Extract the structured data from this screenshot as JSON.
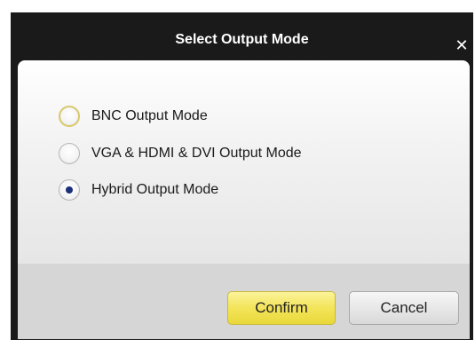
{
  "dialog": {
    "title": "Select Output Mode",
    "close_glyph": "✕",
    "close_icon": "close-icon"
  },
  "options": [
    {
      "label": "BNC Output Mode",
      "checked": false
    },
    {
      "label": "VGA & HDMI & DVI Output Mode",
      "checked": false
    },
    {
      "label": "Hybrid Output Mode",
      "checked": true
    }
  ],
  "buttons": {
    "confirm_label": "Confirm",
    "cancel_label": "Cancel"
  },
  "colors": {
    "titlebar": "#1a1a1a",
    "confirm_bg": "#f3e45a",
    "radio_dot": "#1b2f7a"
  }
}
